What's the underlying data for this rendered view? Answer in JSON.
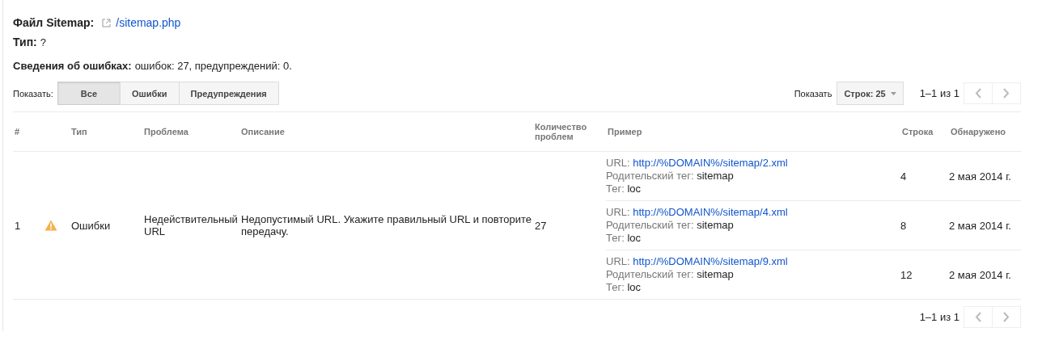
{
  "sitemap_file": {
    "label": "Файл Sitemap:",
    "link": "/sitemap.php"
  },
  "type": {
    "label": "Тип:",
    "value": "?"
  },
  "error_summary": {
    "label": "Сведения об ошибках:",
    "value": "ошибок: 27, предупреждений: 0."
  },
  "filter": {
    "label": "Показать:",
    "buttons": [
      {
        "label": "Все",
        "selected": true
      },
      {
        "label": "Ошибки",
        "selected": false
      },
      {
        "label": "Предупреждения",
        "selected": false
      }
    ]
  },
  "rows_select": {
    "label": "Показать",
    "value": "Строк: 25"
  },
  "pagination_top": {
    "text": "1–1 из 1"
  },
  "table": {
    "columns": [
      "#",
      "Тип",
      "Проблема",
      "Описание",
      "Количество проблем",
      "Пример",
      "Строка",
      "Обнаружено"
    ],
    "rows": [
      {
        "number": "1",
        "kind": "warning",
        "type": "Ошибки",
        "problem": "Недействительный URL",
        "description": "Недопустимый URL. Укажите правильный URL и повторите передачу.",
        "count": "27",
        "examples": [
          {
            "url_label": "URL:",
            "url": "http://%DOMAIN%/sitemap/2.xml",
            "parent_label": "Родительский тег:",
            "parent": "sitemap",
            "tag_label": "Тег:",
            "tag": "loc",
            "line": "4",
            "detected": "2 мая 2014 г."
          },
          {
            "url_label": "URL:",
            "url": "http://%DOMAIN%/sitemap/4.xml",
            "parent_label": "Родительский тег:",
            "parent": "sitemap",
            "tag_label": "Тег:",
            "tag": "loc",
            "line": "8",
            "detected": "2 мая 2014 г."
          },
          {
            "url_label": "URL:",
            "url": "http://%DOMAIN%/sitemap/9.xml",
            "parent_label": "Родительский тег:",
            "parent": "sitemap",
            "tag_label": "Тег:",
            "tag": "loc",
            "line": "12",
            "detected": "2 мая 2014 г."
          }
        ]
      }
    ]
  },
  "pagination_bottom": {
    "text": "1–1 из 1"
  }
}
